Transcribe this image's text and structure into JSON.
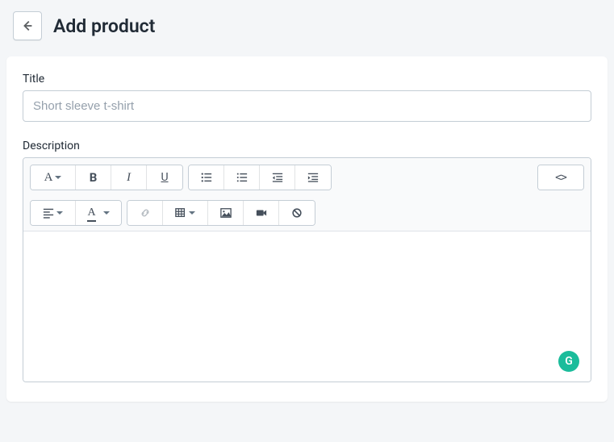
{
  "header": {
    "title": "Add product"
  },
  "titleField": {
    "label": "Title",
    "placeholder": "Short sleeve t-shirt",
    "value": ""
  },
  "descriptionField": {
    "label": "Description"
  },
  "toolbar": {
    "paragraph": "A",
    "bold": "B",
    "italic": "I",
    "underline": "U",
    "textColor": "A",
    "codeView": "<>"
  },
  "grammarly": {
    "badge": "G"
  }
}
